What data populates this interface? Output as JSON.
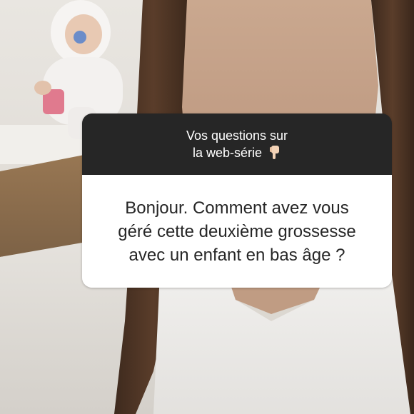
{
  "story": {
    "question_sticker": {
      "header_line1": "Vos questions sur",
      "header_line2": "la web-série",
      "header_icon": "pointing-down-hand-icon",
      "question_text": "Bonjour. Comment avez vous\ngéré cette deuxième grossesse\navec un enfant en bas âge ?"
    },
    "colors": {
      "sticker_header_bg": "#262626",
      "sticker_body_bg": "#ffffff",
      "text_dark": "#262626",
      "text_light": "#ffffff"
    }
  }
}
